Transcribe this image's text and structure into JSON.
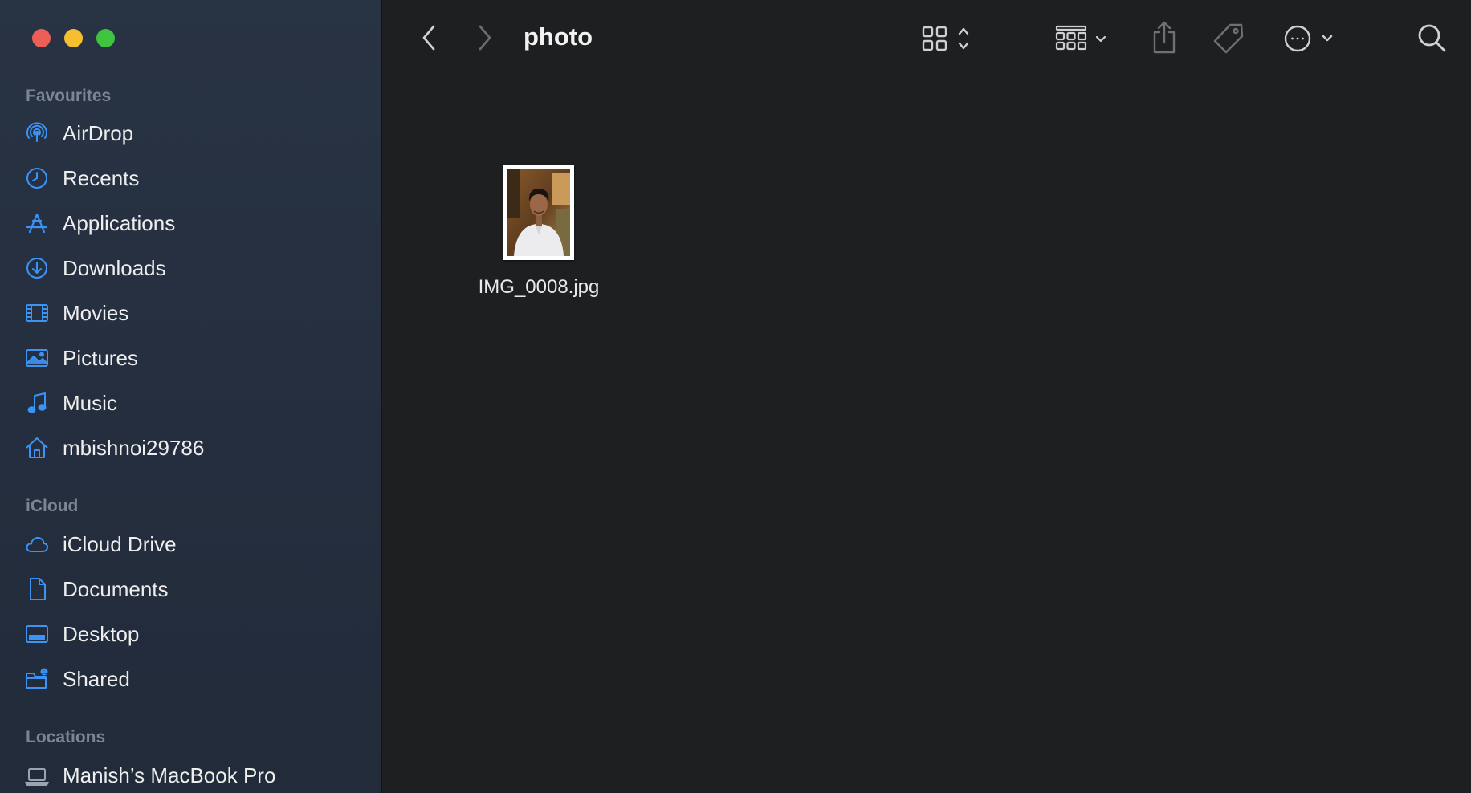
{
  "window": {
    "title": "photo"
  },
  "toolbar": {
    "back_icon": "chevron-left-icon",
    "forward_icon": "chevron-right-icon",
    "view_icon": "icon-grid-icon",
    "group_icon": "group-grid-icon",
    "share_icon": "share-icon",
    "tag_icon": "tag-icon",
    "more_icon": "ellipsis-circle-icon",
    "search_icon": "search-icon"
  },
  "sidebar": {
    "favourites_title": "Favourites",
    "favourites": [
      {
        "label": "AirDrop",
        "icon": "airdrop-icon"
      },
      {
        "label": "Recents",
        "icon": "clock-icon"
      },
      {
        "label": "Applications",
        "icon": "applications-icon"
      },
      {
        "label": "Downloads",
        "icon": "download-icon"
      },
      {
        "label": "Movies",
        "icon": "film-icon"
      },
      {
        "label": "Pictures",
        "icon": "photo-icon"
      },
      {
        "label": "Music",
        "icon": "music-note-icon"
      },
      {
        "label": "mbishnoi29786",
        "icon": "home-icon"
      }
    ],
    "icloud_title": "iCloud",
    "icloud": [
      {
        "label": "iCloud Drive",
        "icon": "cloud-icon"
      },
      {
        "label": "Documents",
        "icon": "document-icon"
      },
      {
        "label": "Desktop",
        "icon": "desktop-icon"
      },
      {
        "label": "Shared",
        "icon": "shared-folder-icon"
      }
    ],
    "locations_title": "Locations",
    "locations": [
      {
        "label": "Manish’s MacBook Pro",
        "icon": "laptop-icon"
      }
    ]
  },
  "files": [
    {
      "name": "IMG_0008.jpg"
    }
  ],
  "colors": {
    "accent": "#2f8cf0",
    "sidebar_bg": "#263142",
    "main_bg": "#1e1f21"
  }
}
